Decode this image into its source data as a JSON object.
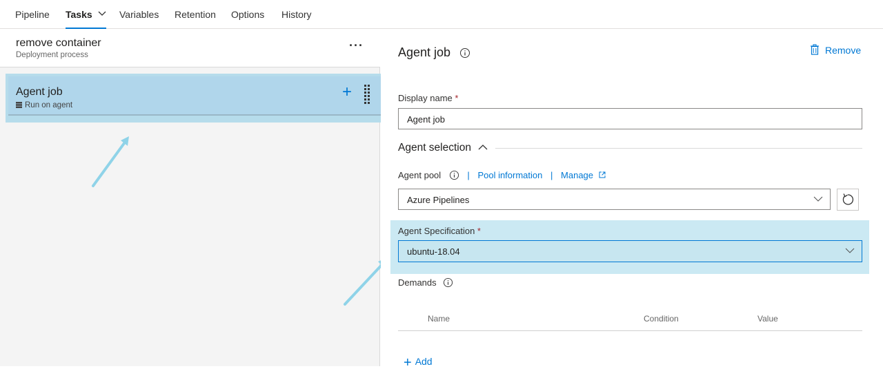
{
  "nav": {
    "tabs": [
      {
        "label": "Pipeline"
      },
      {
        "label": "Tasks"
      },
      {
        "label": "Variables"
      },
      {
        "label": "Retention"
      },
      {
        "label": "Options"
      },
      {
        "label": "History"
      }
    ]
  },
  "process": {
    "title": "remove container",
    "subtitle": "Deployment process",
    "more_label": "···"
  },
  "job": {
    "title": "Agent job",
    "subtitle": "Run on agent",
    "add_label": "+"
  },
  "details": {
    "title": "Agent job",
    "remove_label": "Remove",
    "display_name_label": "Display name",
    "required_mark": "*",
    "display_name_value": "Agent job",
    "agent_selection_label": "Agent selection",
    "agent_pool_label": "Agent pool",
    "pool_info_link": "Pool information",
    "manage_link": "Manage",
    "separator": "|",
    "agent_pool_value": "Azure Pipelines",
    "agent_spec_label": "Agent Specification",
    "agent_spec_value": "ubuntu-18.04",
    "demands_label": "Demands",
    "columns": [
      "Name",
      "Condition",
      "Value"
    ],
    "add_label": "Add"
  },
  "colors": {
    "accent": "#0078d4",
    "highlight": "#b6dceb",
    "arrow": "#8fd3e8"
  },
  "icons": {
    "info": "info-icon",
    "trash": "trash-icon",
    "refresh": "refresh-icon",
    "external": "external-link-icon",
    "server": "server-icon"
  }
}
